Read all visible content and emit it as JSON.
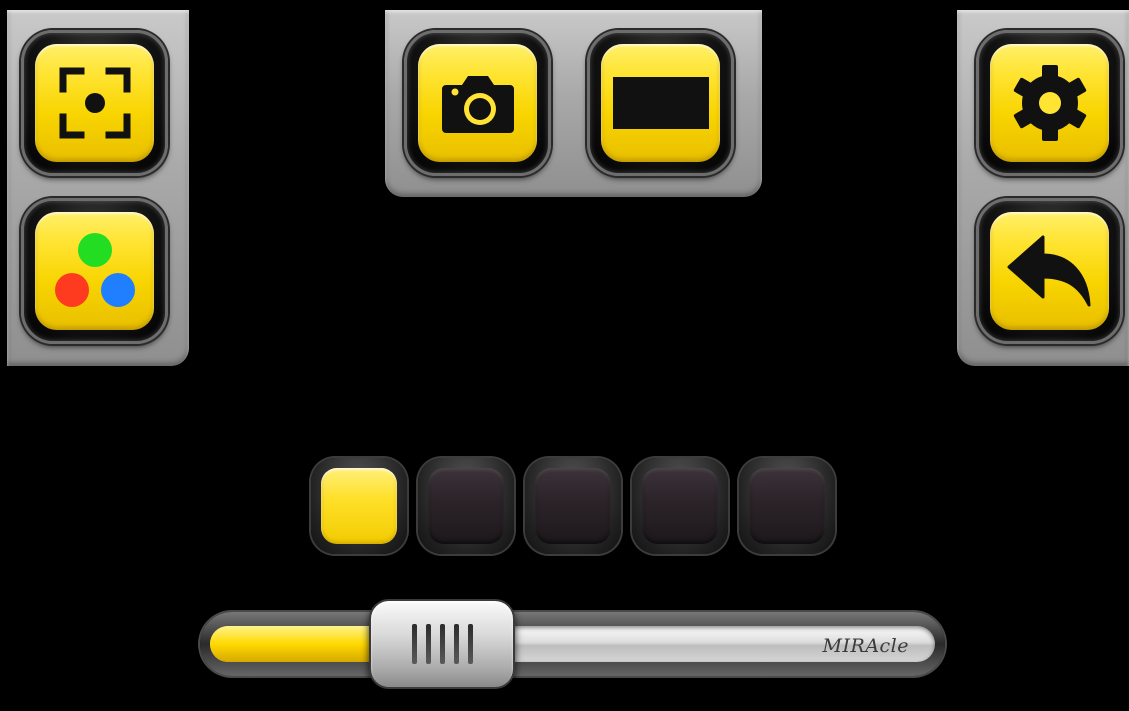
{
  "toolbar": {
    "buttons": [
      {
        "id": "focus",
        "icon": "focus-target-icon"
      },
      {
        "id": "color",
        "icon": "color-dots-icon",
        "colors": [
          "#22dd22",
          "#ff3b1f",
          "#1f7fff"
        ]
      },
      {
        "id": "camera",
        "icon": "camera-icon"
      },
      {
        "id": "display",
        "icon": "black-bar-icon"
      },
      {
        "id": "settings",
        "icon": "gear-icon"
      },
      {
        "id": "back",
        "icon": "back-arrow-icon"
      }
    ]
  },
  "level_selector": {
    "count": 5,
    "selected_index": 0,
    "active_color": "#ffe02a",
    "inactive_color": "#2b2328"
  },
  "slider": {
    "brand_label": "MIRAcle",
    "value_fraction": 0.26,
    "fill_color": "#ffd900"
  },
  "colors": {
    "accent_yellow": "#ffe433",
    "panel_gray": "#a9a9a9",
    "background": "#000000"
  }
}
